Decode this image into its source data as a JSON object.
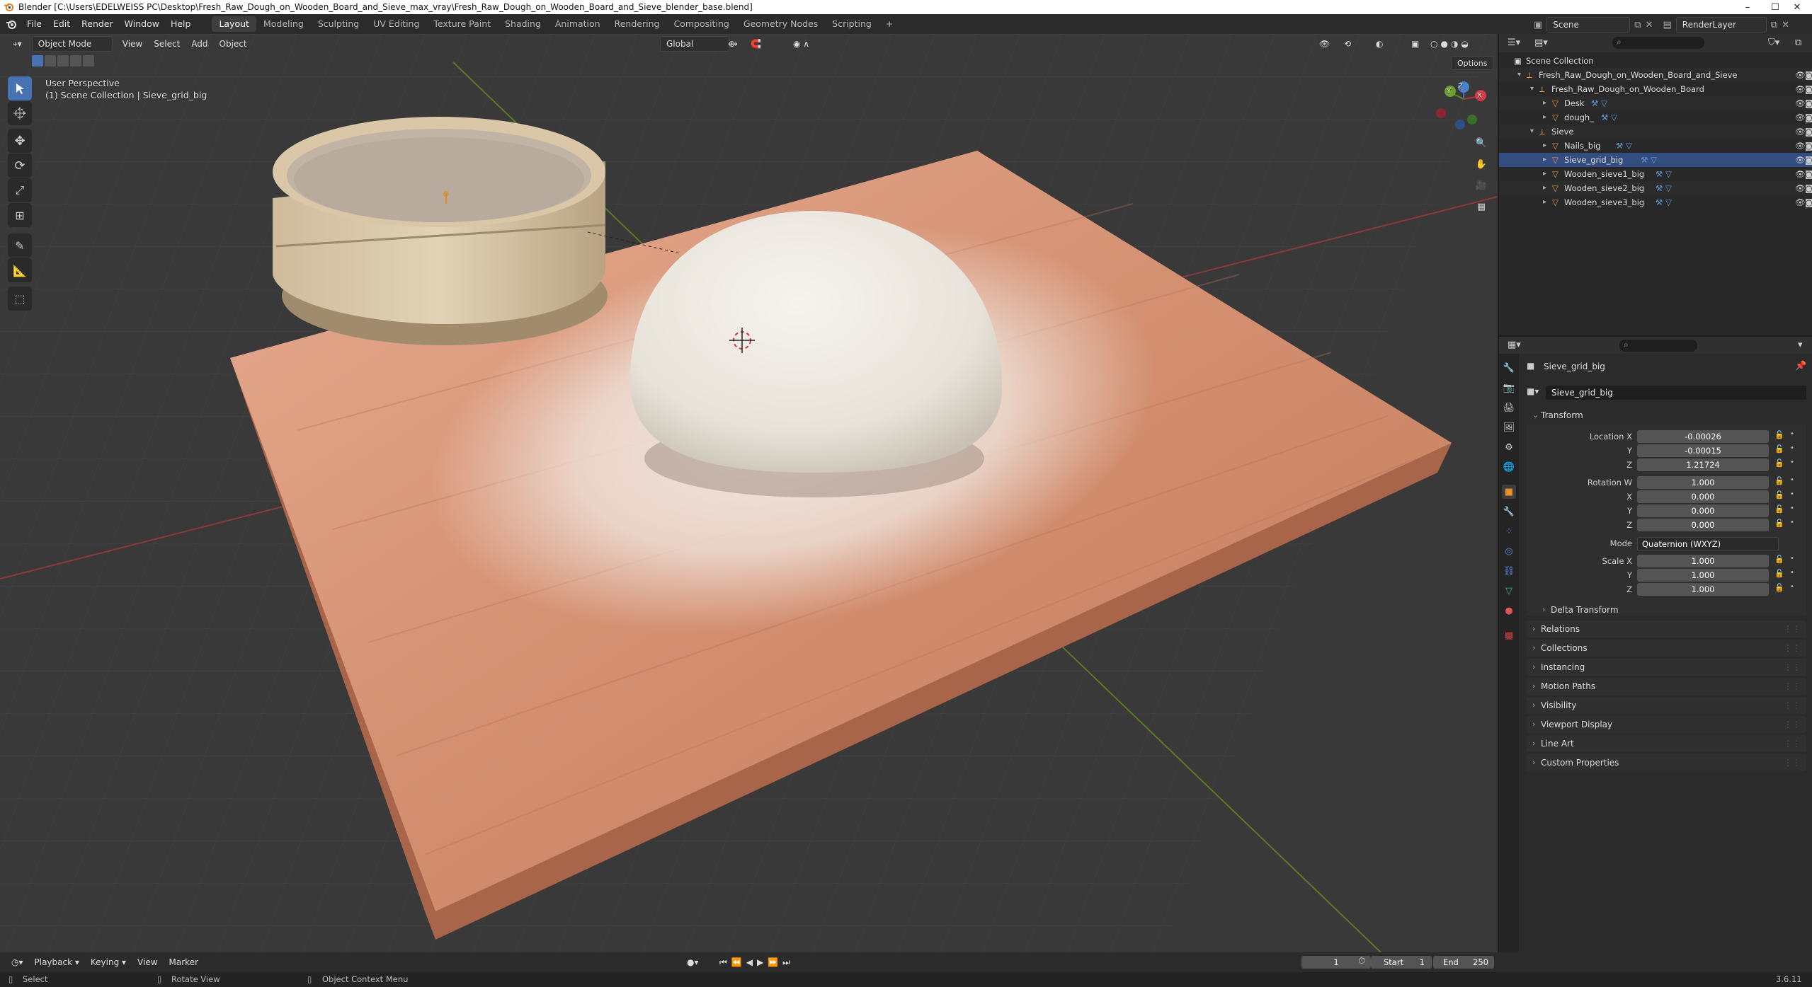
{
  "title_bar": {
    "text": "Blender [C:\\Users\\EDELWEISS PC\\Desktop\\Fresh_Raw_Dough_on_Wooden_Board_and_Sieve_max_vray\\Fresh_Raw_Dough_on_Wooden_Board_and_Sieve_blender_base.blend]",
    "minimize": "–",
    "maximize": "☐",
    "close": "✕"
  },
  "menu": {
    "items": [
      "File",
      "Edit",
      "Render",
      "Window",
      "Help"
    ],
    "workspaces": [
      "Layout",
      "Modeling",
      "Sculpting",
      "UV Editing",
      "Texture Paint",
      "Shading",
      "Animation",
      "Rendering",
      "Compositing",
      "Geometry Nodes",
      "Scripting"
    ],
    "active_workspace": "Layout",
    "add_tab": "+",
    "scene_label": "Scene",
    "render_layer": "RenderLayer"
  },
  "viewport_header": {
    "mode": "Object Mode",
    "menus": [
      "View",
      "Select",
      "Add",
      "Object"
    ],
    "orientation": "Global",
    "options": "Options"
  },
  "viewport": {
    "perspective": "User Perspective",
    "collection_info": "(1) Scene Collection | Sieve_grid_big",
    "gizmo_axes": [
      "X",
      "Y",
      "Z"
    ]
  },
  "outliner": {
    "search_placeholder": "",
    "rows": [
      {
        "label": "Scene Collection",
        "depth": 0,
        "type": "collection"
      },
      {
        "label": "Fresh_Raw_Dough_on_Wooden_Board_and_Sieve",
        "depth": 1,
        "type": "empty"
      },
      {
        "label": "Fresh_Raw_Dough_on_Wooden_Board",
        "depth": 2,
        "type": "empty"
      },
      {
        "label": "Desk",
        "depth": 3,
        "type": "mesh"
      },
      {
        "label": "dough_",
        "depth": 3,
        "type": "mesh"
      },
      {
        "label": "Sieve",
        "depth": 2,
        "type": "empty"
      },
      {
        "label": "Nails_big",
        "depth": 3,
        "type": "mesh"
      },
      {
        "label": "Sieve_grid_big",
        "depth": 3,
        "type": "mesh"
      },
      {
        "label": "Wooden_sieve1_big",
        "depth": 3,
        "type": "mesh"
      },
      {
        "label": "Wooden_sieve2_big",
        "depth": 3,
        "type": "mesh"
      },
      {
        "label": "Wooden_sieve3_big",
        "depth": 3,
        "type": "mesh"
      }
    ]
  },
  "properties": {
    "object_name": "Sieve_grid_big",
    "object_field": "Sieve_grid_big",
    "transform_header": "Transform",
    "location_label": "Location X",
    "location": [
      "-0.00026",
      "-0.00015",
      "1.21724"
    ],
    "rotation_label": "Rotation W",
    "rotation": [
      "1.000",
      "0.000",
      "0.000",
      "0.000"
    ],
    "mode_label": "Mode",
    "mode_value": "Quaternion (WXYZ)",
    "scale_label": "Scale X",
    "scale": [
      "1.000",
      "1.000",
      "1.000"
    ],
    "axis_y": "Y",
    "axis_z": "Z",
    "axis_x": "X",
    "delta": "Delta Transform",
    "panels": [
      "Relations",
      "Collections",
      "Instancing",
      "Motion Paths",
      "Visibility",
      "Viewport Display",
      "Line Art",
      "Custom Properties"
    ]
  },
  "timeline": {
    "menus": [
      "Playback",
      "Keying",
      "View",
      "Marker"
    ],
    "current_frame": "1",
    "start_label": "Start",
    "start": "1",
    "end_label": "End",
    "end": "250"
  },
  "status": {
    "select": "Select",
    "rotate": "Rotate View",
    "context": "Object Context Menu",
    "version": "3.6.11"
  }
}
